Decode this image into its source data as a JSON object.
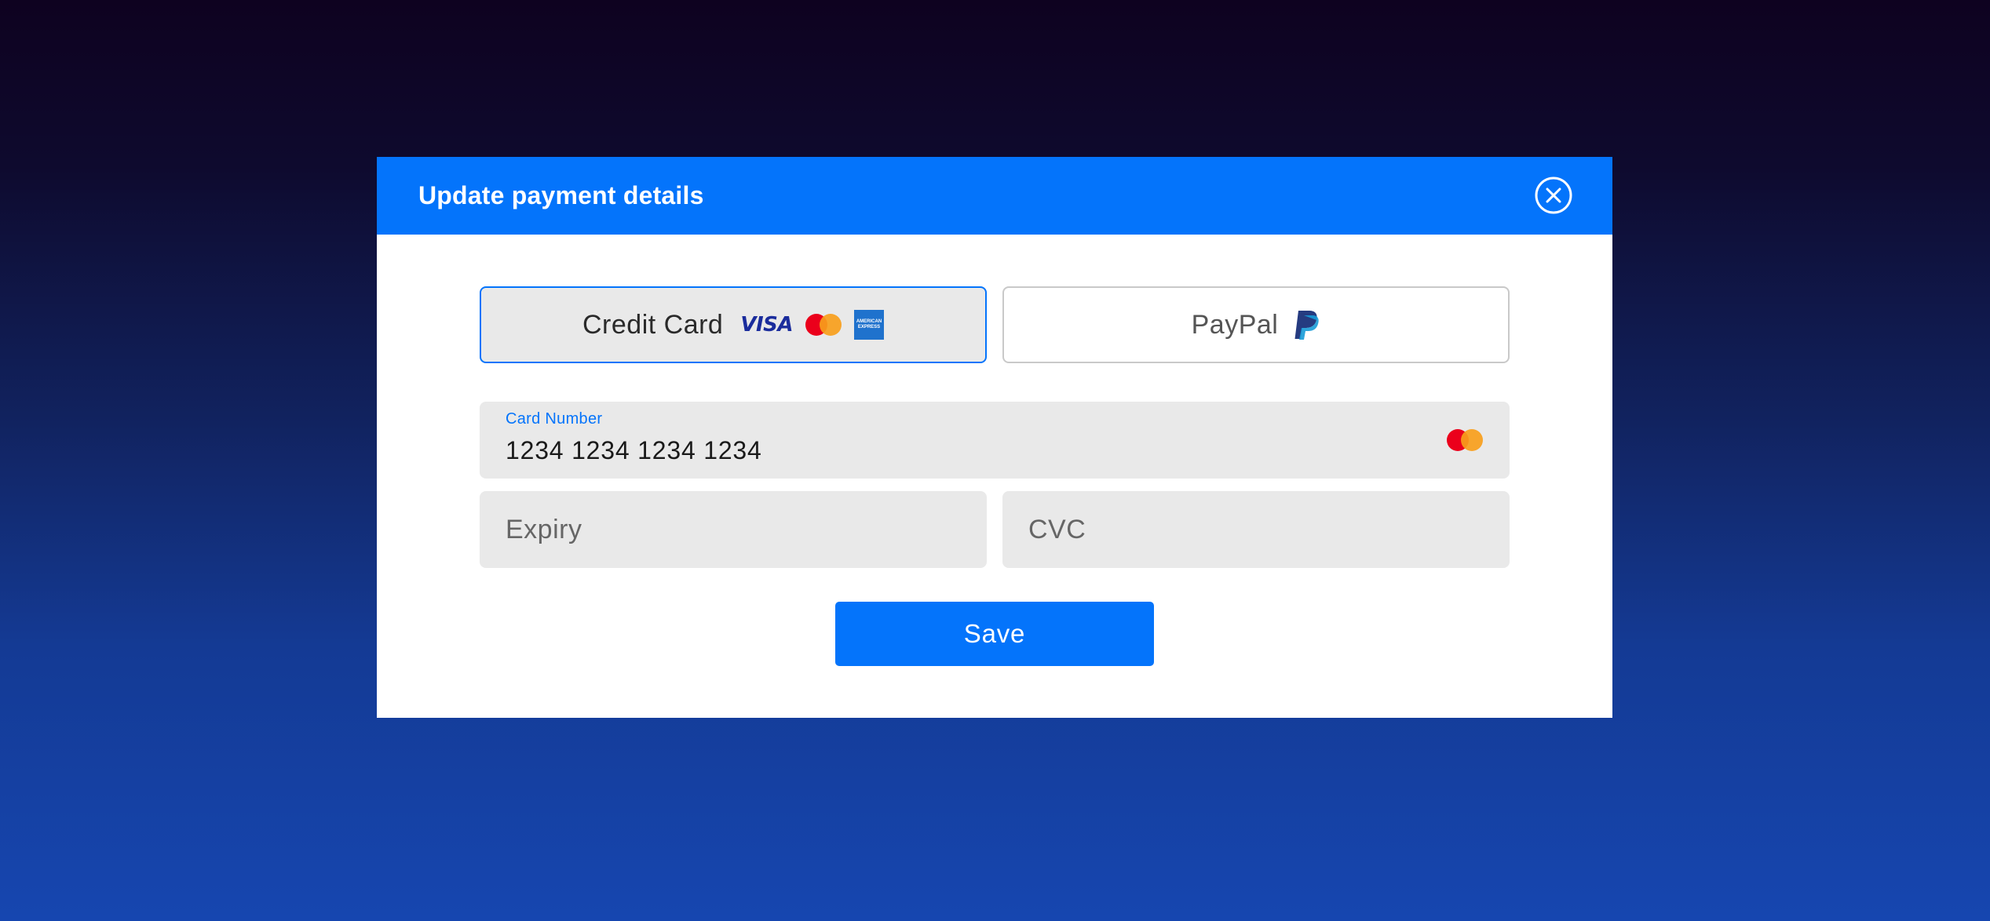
{
  "modal": {
    "title": "Update payment details",
    "close_icon": "close-circle-icon"
  },
  "payment_methods": [
    {
      "label": "Credit Card",
      "selected": true,
      "icons": [
        "visa-icon",
        "mastercard-icon",
        "amex-icon"
      ],
      "visa_text": "VISA",
      "amex_text": [
        "AMERICAN",
        "EXPRESS"
      ]
    },
    {
      "label": "PayPal",
      "selected": false,
      "icons": [
        "paypal-icon"
      ]
    }
  ],
  "card_number": {
    "label": "Card Number",
    "value": "1234 1234 1234 1234",
    "brand_icon": "mastercard-icon"
  },
  "expiry": {
    "placeholder": "Expiry"
  },
  "cvc": {
    "placeholder": "CVC"
  },
  "save_button": {
    "label": "Save"
  },
  "colors": {
    "accent": "#0474fb",
    "field_background": "#e9e9e9",
    "mastercard_red": "#eb001b",
    "mastercard_orange": "#f79e1b",
    "visa_blue": "#1a2c9c",
    "amex_blue": "#1f72cd",
    "paypal_dark": "#253b80",
    "paypal_light": "#179bd7"
  }
}
